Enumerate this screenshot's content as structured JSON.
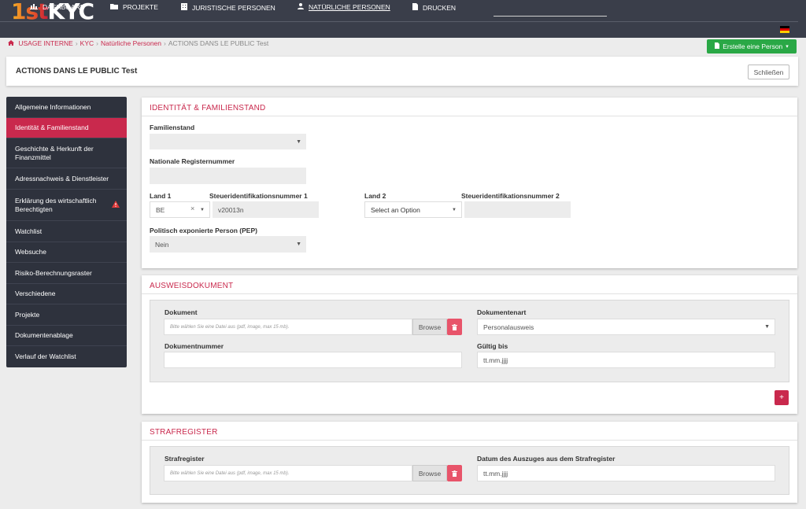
{
  "app": {
    "logo_num": "1st",
    "logo_text": "KYC"
  },
  "nav": {
    "items": [
      {
        "label": "DASHBOARD",
        "icon": "bar-chart-icon"
      },
      {
        "label": "PROJEKTE",
        "icon": "folder-icon"
      },
      {
        "label": "JURISTISCHE PERSONEN",
        "icon": "building-icon"
      },
      {
        "label": "NATÜRLICHE PERSONEN",
        "icon": "user-icon"
      },
      {
        "label": "DRUCKEN",
        "icon": "file-icon"
      }
    ],
    "language_flag": "de-flag-icon"
  },
  "breadcrumb": {
    "items": [
      "USAGE INTERNE",
      "KYC",
      "Natürliche Personen",
      "ACTIONS DANS LE PUBLIC Test"
    ],
    "separator": "›"
  },
  "create_button": {
    "label": "Erstelle eine Person",
    "caret": "▾"
  },
  "page": {
    "title": "ACTIONS DANS LE PUBLIC Test",
    "close_label": "Schließen"
  },
  "sidebar": {
    "items": [
      {
        "label": "Allgemeine Informationen",
        "active": false
      },
      {
        "label": "Identität & Familienstand",
        "active": true
      },
      {
        "label": "Geschichte & Herkunft der Finanzmittel",
        "active": false
      },
      {
        "label": "Adressnachweis & Dienstleister",
        "active": false
      },
      {
        "label": "Erklärung des wirtschaftlich Berechtigten",
        "active": false,
        "warning": true
      },
      {
        "label": "Watchlist",
        "active": false
      },
      {
        "label": "Websuche",
        "active": false
      },
      {
        "label": "Risiko-Berechnungsraster",
        "active": false
      },
      {
        "label": "Verschiedene",
        "active": false
      },
      {
        "label": "Projekte",
        "active": false
      },
      {
        "label": "Dokumentenablage",
        "active": false
      },
      {
        "label": "Verlauf der Watchlist",
        "active": false
      }
    ]
  },
  "identity": {
    "title": "IDENTITÄT & FAMILIENSTAND",
    "familienstand": {
      "label": "Familienstand",
      "value": ""
    },
    "register": {
      "label": "Nationale Registernummer",
      "value": ""
    },
    "land1": {
      "label": "Land 1",
      "value": "BE",
      "clear": "×"
    },
    "steuer1": {
      "label": "Steueridentifikationsnummer 1",
      "value": "v20013n"
    },
    "land2": {
      "label": "Land 2",
      "placeholder": "Select an Option"
    },
    "steuer2": {
      "label": "Steueridentifikationsnummer 2",
      "value": ""
    },
    "pep": {
      "label": "Politisch exponierte Person (PEP)",
      "value": "Nein"
    }
  },
  "ausweis": {
    "title": "AUSWEISDOKUMENT",
    "dokument": {
      "label": "Dokument",
      "placeholder": "Bitte wählen Sie eine Datei aus (pdf, image, max 15 mb).",
      "browse": "Browse"
    },
    "dokumentenart": {
      "label": "Dokumentenart",
      "value": "Personalausweis"
    },
    "dokumentnummer": {
      "label": "Dokumentnummer",
      "value": ""
    },
    "gueltig": {
      "label": "Gültig bis",
      "value": "tt.mm.jjjj"
    },
    "add_label": "+"
  },
  "strafregister": {
    "title": "STRAFREGISTER",
    "file": {
      "label": "Strafregister",
      "placeholder": "Bitte wählen Sie eine Datei aus (pdf, image, max 15 mb).",
      "browse": "Browse"
    },
    "datum": {
      "label": "Datum des Auszuges aus dem Strafregister",
      "value": "tt.mm.jjjj"
    }
  },
  "colors": {
    "accent": "#c9294d",
    "nav_bg": "#3a3e4a",
    "sidebar_bg": "#2e323d",
    "create_green": "#2aa846"
  }
}
